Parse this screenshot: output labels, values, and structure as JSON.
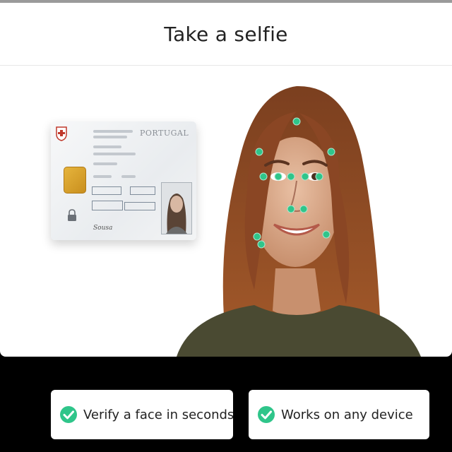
{
  "header": {
    "title": "Take a selfie"
  },
  "id_card": {
    "header_text": "PORTUGAL",
    "signature": "Sousa"
  },
  "features": [
    {
      "label": "Verify a face in seconds",
      "icon": "check-circle-icon"
    },
    {
      "label": "Works on any device",
      "icon": "check-circle-icon"
    }
  ],
  "colors": {
    "accent": "#2fc58a",
    "background_dark": "#000000",
    "card_chip": "#e6b43c"
  }
}
